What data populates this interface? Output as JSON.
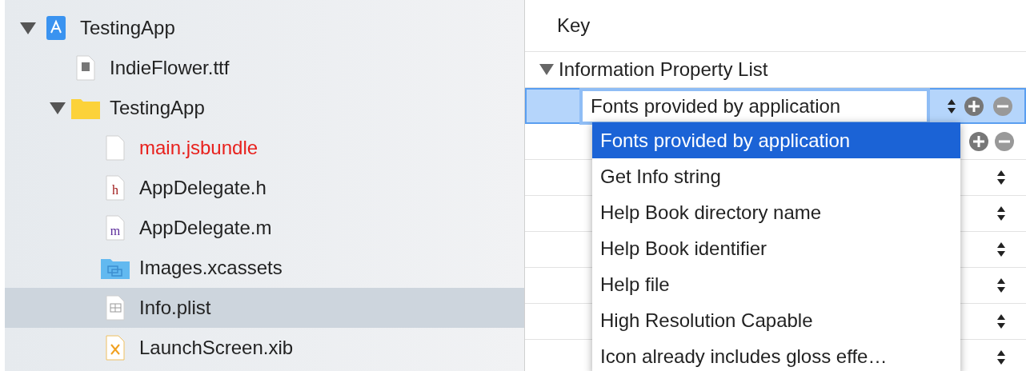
{
  "navigator": {
    "items": [
      {
        "label": "TestingApp",
        "kind": "app",
        "expanded": true,
        "selected": false,
        "missing": false,
        "children": [
          {
            "label": "IndieFlower.ttf",
            "kind": "font",
            "selected": false,
            "missing": false
          },
          {
            "label": "TestingApp",
            "kind": "folder",
            "expanded": true,
            "selected": false,
            "missing": false,
            "children": [
              {
                "label": "main.jsbundle",
                "kind": "blank",
                "selected": false,
                "missing": true
              },
              {
                "label": "AppDelegate.h",
                "kind": "header",
                "icon_letter": "h",
                "selected": false,
                "missing": false
              },
              {
                "label": "AppDelegate.m",
                "kind": "source",
                "icon_letter": "m",
                "selected": false,
                "missing": false
              },
              {
                "label": "Images.xcassets",
                "kind": "assets",
                "selected": false,
                "missing": false
              },
              {
                "label": "Info.plist",
                "kind": "plist",
                "selected": true,
                "missing": false
              },
              {
                "label": "LaunchScreen.xib",
                "kind": "xib",
                "selected": false,
                "missing": false
              }
            ]
          }
        ]
      }
    ]
  },
  "plist_editor": {
    "column_header": "Key",
    "root": {
      "label": "Information Property List",
      "expanded": true
    },
    "key_field": {
      "value": "Fonts provided by application"
    },
    "key_dropdown": {
      "options": [
        {
          "label": "Fonts provided by application",
          "selected": true
        },
        {
          "label": "Get Info string",
          "selected": false
        },
        {
          "label": "Help Book directory name",
          "selected": false
        },
        {
          "label": "Help Book identifier",
          "selected": false
        },
        {
          "label": "Help file",
          "selected": false
        },
        {
          "label": "High Resolution Capable",
          "selected": false
        },
        {
          "label": "Icon already includes gloss effe…",
          "selected": false
        }
      ]
    }
  }
}
